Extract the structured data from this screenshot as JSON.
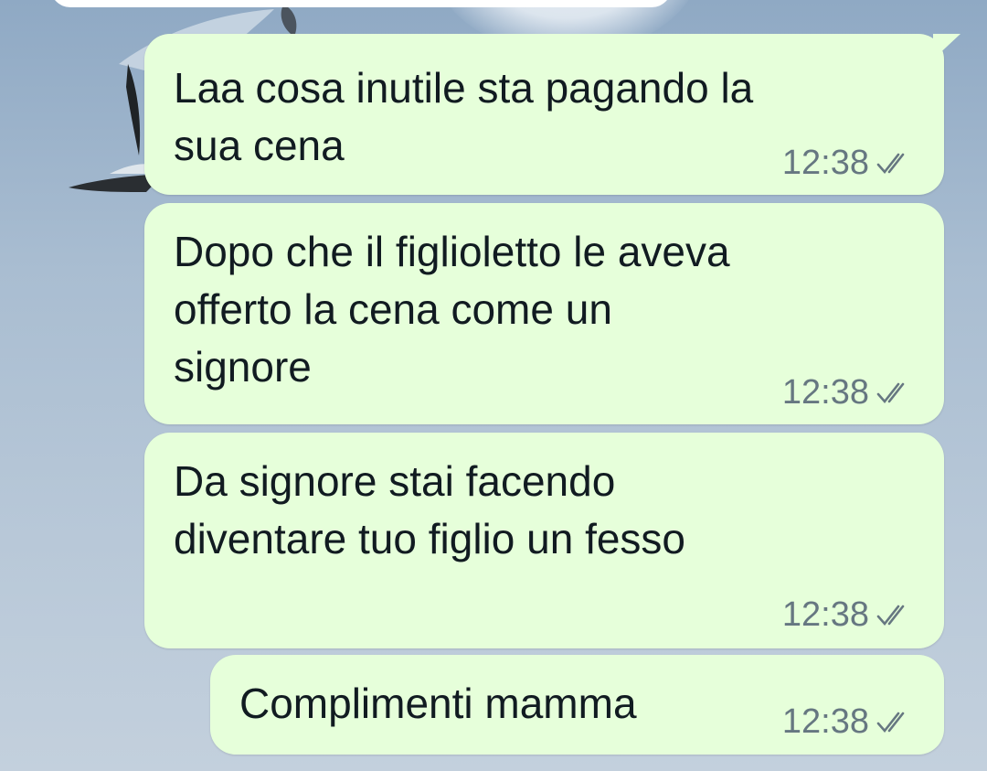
{
  "messages": [
    {
      "text": "Laa cosa inutile sta pagando la\nsua cena",
      "time": "12:38",
      "status_icon": "double-check-icon"
    },
    {
      "text": "Dopo che il figlioletto le aveva\nofferto la cena come un\nsignore",
      "time": "12:38",
      "status_icon": "double-check-icon"
    },
    {
      "text": "Da signore stai facendo\ndiventare tuo figlio un fesso",
      "time": "12:38",
      "status_icon": "double-check-icon"
    },
    {
      "text": "Complimenti mamma",
      "time": "12:38",
      "status_icon": "double-check-icon"
    }
  ],
  "colors": {
    "outgoing_bubble": "#e6ffda",
    "text": "#111b21",
    "meta": "#667781",
    "wallpaper_sky": "#a9bdd1"
  }
}
